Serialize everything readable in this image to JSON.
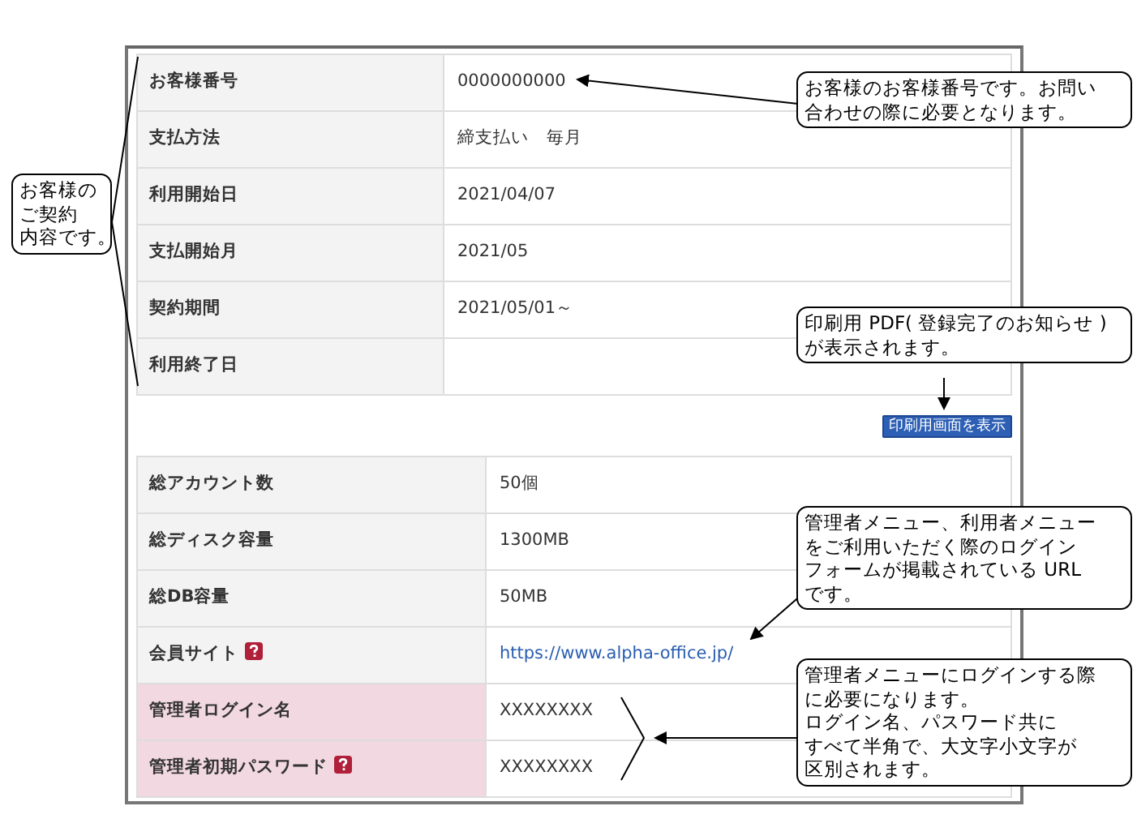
{
  "contract_table": {
    "rows": [
      {
        "label": "お客様番号",
        "value": "0000000000"
      },
      {
        "label": "支払方法",
        "value": "締支払い　毎月"
      },
      {
        "label": "利用開始日",
        "value": "2021/04/07"
      },
      {
        "label": "支払開始月",
        "value": "2021/05"
      },
      {
        "label": "契約期間",
        "value": "2021/05/01～"
      },
      {
        "label": "利用終了日"
      }
    ]
  },
  "print_button": "印刷用画面を表示",
  "account_table": {
    "rows": [
      {
        "label": "総アカウント数",
        "value": "50個",
        "help": false,
        "highlight": false,
        "kind": "text"
      },
      {
        "label": "総ディスク容量",
        "value": "1300MB",
        "help": false,
        "highlight": false,
        "kind": "text"
      },
      {
        "label": "総DB容量",
        "value": "50MB",
        "help": false,
        "highlight": false,
        "kind": "text"
      },
      {
        "label": "会員サイト",
        "value": "https://www.alpha-office.jp/",
        "help": true,
        "highlight": false,
        "kind": "link"
      },
      {
        "label": "管理者ログイン名",
        "value": "XXXXXXXX",
        "help": false,
        "highlight": true,
        "kind": "text"
      },
      {
        "label": "管理者初期パスワード",
        "value": "XXXXXXXX",
        "help": true,
        "highlight": true,
        "kind": "text"
      }
    ]
  },
  "callouts": [
    {
      "lines": [
        "お客様の",
        "ご契約",
        "内容です。"
      ]
    },
    {
      "lines": [
        "お客様のお客様番号です。お問い",
        "合わせの際に必要となります。"
      ]
    },
    {
      "lines": [
        "印刷用 PDF( 登録完了のお知らせ )",
        "が表示されます。"
      ]
    },
    {
      "lines": [
        "管理者メニュー、利用者メニュー",
        "をご利用いただく際のログイン",
        "フォームが掲載されている URL",
        "です。"
      ]
    },
    {
      "lines": [
        "管理者メニューにログインする際",
        "に必要になります。",
        "ログイン名、パスワード共に",
        "すべて半角で、大文字小文字が",
        "区別されます。"
      ]
    }
  ]
}
